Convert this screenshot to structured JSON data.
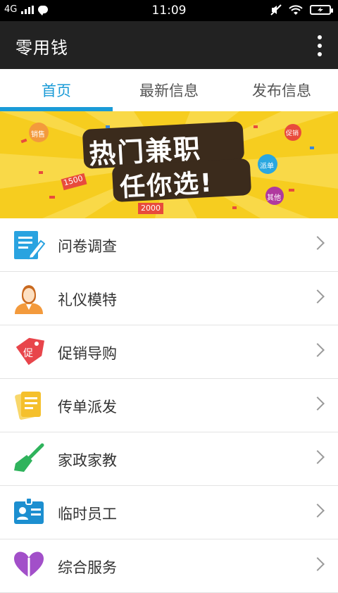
{
  "status_bar": {
    "network": "4G",
    "time": "11:09"
  },
  "app_bar": {
    "title": "零用钱"
  },
  "tabs": [
    {
      "label": "首页",
      "active": true
    },
    {
      "label": "最新信息",
      "active": false
    },
    {
      "label": "发布信息",
      "active": false
    }
  ],
  "banner": {
    "line1": "热门兼职",
    "line2": "任你选!",
    "chips": [
      "1500",
      "2000"
    ],
    "bubbles": [
      "销售",
      "促销",
      "派单",
      "其他"
    ]
  },
  "list": {
    "items": [
      {
        "label": "问卷调查",
        "icon": "survey-icon",
        "color": "#2aa3e0"
      },
      {
        "label": "礼仪模特",
        "icon": "model-icon",
        "color": "#f39a3c"
      },
      {
        "label": "促销导购",
        "icon": "promo-tag-icon",
        "color": "#e8454b"
      },
      {
        "label": "传单派发",
        "icon": "flyer-icon",
        "color": "#f5c02c"
      },
      {
        "label": "家政家教",
        "icon": "broom-icon",
        "color": "#2fb35c"
      },
      {
        "label": "临时员工",
        "icon": "badge-icon",
        "color": "#1c8fd0"
      },
      {
        "label": "综合服务",
        "icon": "service-icon",
        "color": "#a24fc9"
      }
    ]
  },
  "colors": {
    "accent": "#1a9bd7",
    "appbar": "#222222",
    "banner_bg": "#f6cd1f"
  }
}
